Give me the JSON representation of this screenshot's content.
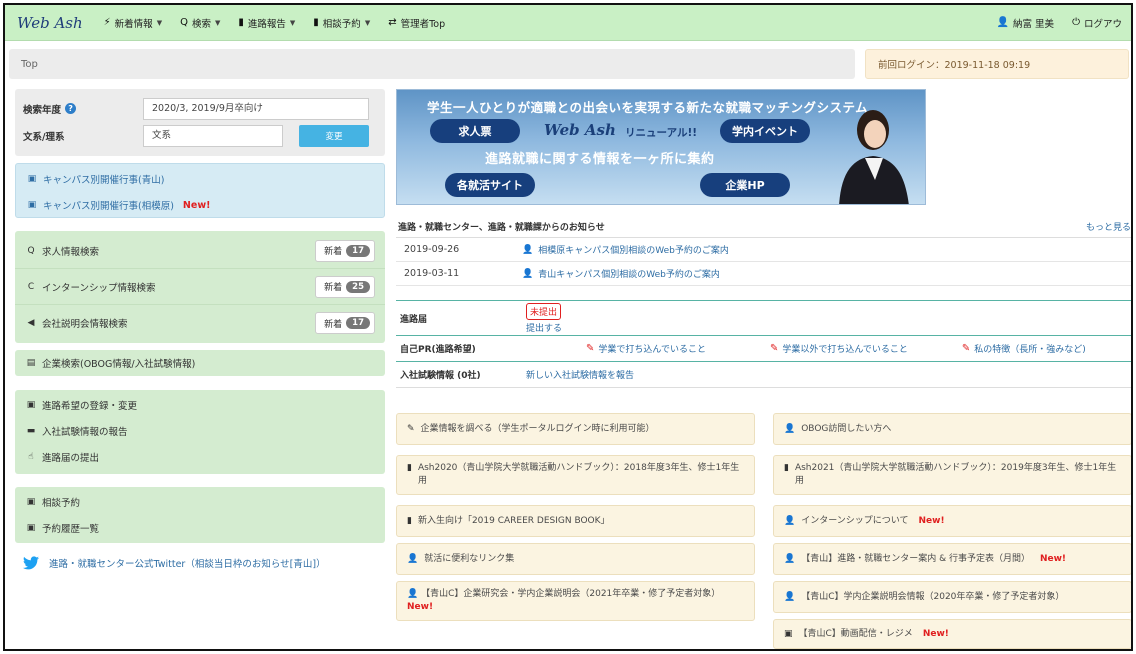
{
  "nav": {
    "brand": "Web Ash",
    "items": [
      {
        "icon": "⚡",
        "label": "新着情報"
      },
      {
        "icon": "🔍",
        "label": "検索"
      },
      {
        "icon": "▮",
        "label": "進路報告"
      },
      {
        "icon": "▮",
        "label": "相談予約"
      },
      {
        "icon": "⇄",
        "label": "管理者Top"
      }
    ],
    "user_name": "納富 里美",
    "logout": "ログアウ"
  },
  "breadcrumb": "Top",
  "last_login": "前回ログイン：2019-11-18 09:19",
  "search": {
    "year_label": "検索年度",
    "year_value": "2020/3, 2019/9月卒向け",
    "field_label": "文系/理系",
    "field_value": "文系",
    "change_button": "変更"
  },
  "campus_events": [
    {
      "label": "キャンパス別開催行事(青山)",
      "new": ""
    },
    {
      "label": "キャンパス別開催行事(相模原)",
      "new": "New!"
    }
  ],
  "searches": [
    {
      "icon": "🔍",
      "label": "求人情報検索",
      "new_label": "新着",
      "count": "17"
    },
    {
      "icon": "C",
      "label": "インターンシップ情報検索",
      "new_label": "新着",
      "count": "25"
    },
    {
      "icon": "📢",
      "label": "会社説明会情報検索",
      "new_label": "新着",
      "count": "17"
    }
  ],
  "company_search": "企業検索(OBOG情報/入社試験情報)",
  "reports": [
    {
      "icon": "▣",
      "label": "進路希望の登録・変更"
    },
    {
      "icon": "▬",
      "label": "入社試験情報の報告"
    },
    {
      "icon": "☝",
      "label": "進路届の提出"
    }
  ],
  "consult": [
    {
      "icon": "▣",
      "label": "相談予約"
    },
    {
      "icon": "▣",
      "label": "予約履歴一覧"
    }
  ],
  "twitter": "進路・就職センター公式Twitter（相談当日枠のお知らせ[青山]）",
  "banner": {
    "top": "学生一人ひとりが適職との出会いを実現する新たな就職マッチングシステム",
    "pill1": "求人票",
    "logo": "Web Ash",
    "renew": "リニューアル!!",
    "pill2": "学内イベント",
    "mid": "進路就職に関する情報を一ヶ所に集約",
    "pill3": "各就活サイト",
    "pill4": "企業HP"
  },
  "notices": {
    "title": "進路・就職センター、進路・就職課からのお知らせ",
    "more": "もっと見る",
    "rows": [
      {
        "date": "2019-09-26",
        "text": "相模原キャンパス個別相談のWeb予約のご案内"
      },
      {
        "date": "2019-03-11",
        "text": "青山キャンパス個別相談のWeb予約のご案内"
      }
    ]
  },
  "info": {
    "route_label": "進路届",
    "route_status": "未提出",
    "route_submit": "提出する",
    "pr_label": "自己PR(進路希望)",
    "pr_links": [
      "学業で打ち込んでいること",
      "学業以外で打ち込んでいること",
      "私の特徴（長所・強みなど)"
    ],
    "exam_label": "入社試験情報 (0社)",
    "exam_link": "新しい入社試験情報を報告"
  },
  "tiles": [
    {
      "icon": "✎",
      "text": "企業情報を調べる（学生ポータルログイン時に利用可能）",
      "new": ""
    },
    {
      "icon": "👤",
      "text": "OBOG訪問したい方へ",
      "new": ""
    },
    {
      "icon": "▮",
      "text": "Ash2020（青山学院大学就職活動ハンドブック）：2018年度3年生、修士1年生用",
      "new": ""
    },
    {
      "icon": "▮",
      "text": "Ash2021（青山学院大学就職活動ハンドブック）：2019年度3年生、修士1年生用",
      "new": ""
    },
    {
      "icon": "▮",
      "text": "新入生向け「2019 CAREER DESIGN BOOK」",
      "new": ""
    },
    {
      "icon": "👤",
      "text": "インターンシップについて",
      "new": "New!"
    },
    {
      "icon": "👤",
      "text": "就活に便利なリンク集",
      "new": ""
    },
    {
      "icon": "👤",
      "text": "【青山】進路・就職センター案内 & 行事予定表（月間）",
      "new": "New!"
    },
    {
      "icon": "👤",
      "text": "【青山C】企業研究会・学内企業説明会（2021年卒業・修了予定者対象）",
      "new": "New!"
    },
    {
      "icon": "👤",
      "text": "【青山C】学内企業説明会情報（2020年卒業・修了予定者対象）",
      "new": ""
    },
    {
      "icon": "▣",
      "text": "【青山C】動画配信・レジメ",
      "new": "New!"
    }
  ]
}
